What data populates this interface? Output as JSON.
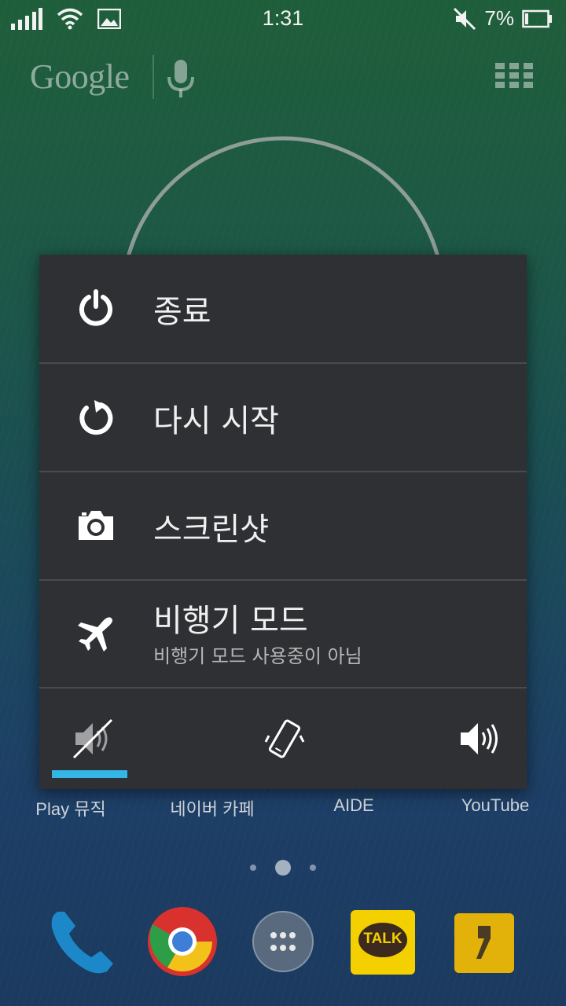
{
  "status_bar": {
    "time": "1:31",
    "battery_percent": "7%",
    "icons": [
      "signal-icon",
      "wifi-icon",
      "image-notification-icon",
      "mute-icon",
      "battery-icon"
    ]
  },
  "search": {
    "logo_text": "Google",
    "icons": [
      "mic-icon",
      "apps-grid-icon"
    ]
  },
  "power_menu": {
    "items": [
      {
        "icon": "power-icon",
        "label": "종료"
      },
      {
        "icon": "restart-icon",
        "label": "다시 시작"
      },
      {
        "icon": "camera-icon",
        "label": "스크린샷"
      },
      {
        "icon": "airplane-icon",
        "label": "비행기 모드",
        "sublabel": "비행기 모드 사용중이 아님"
      }
    ],
    "sound_modes": [
      {
        "icon": "silent-icon",
        "selected": true
      },
      {
        "icon": "vibrate-icon",
        "selected": false
      },
      {
        "icon": "sound-on-icon",
        "selected": false
      }
    ],
    "accent_color": "#33b5e5"
  },
  "home": {
    "app_labels": [
      "Play 뮤직",
      "네이버 카페",
      "AIDE",
      "YouTube"
    ],
    "dock": [
      "phone-icon",
      "chrome-icon",
      "app-drawer-icon",
      "kakaotalk-icon",
      "kakaostory-icon"
    ],
    "dock_text": {
      "kakaotalk": "TALK"
    }
  }
}
